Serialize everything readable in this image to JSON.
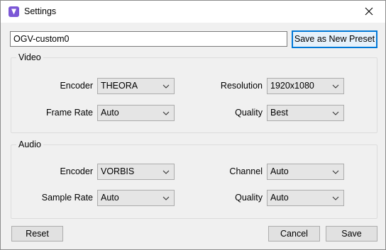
{
  "window": {
    "title": "Settings",
    "accent": "#0078d7",
    "icon_color": "#7b57d6"
  },
  "preset": {
    "value": "OGV-custom0",
    "save_button": "Save as New Preset"
  },
  "video": {
    "group_title": "Video",
    "encoder": {
      "label": "Encoder",
      "value": "THEORA"
    },
    "resolution": {
      "label": "Resolution",
      "value": "1920x1080"
    },
    "frame_rate": {
      "label": "Frame Rate",
      "value": "Auto"
    },
    "quality": {
      "label": "Quality",
      "value": "Best"
    }
  },
  "audio": {
    "group_title": "Audio",
    "encoder": {
      "label": "Encoder",
      "value": "VORBIS"
    },
    "channel": {
      "label": "Channel",
      "value": "Auto"
    },
    "sample_rate": {
      "label": "Sample Rate",
      "value": "Auto"
    },
    "quality": {
      "label": "Quality",
      "value": "Auto"
    }
  },
  "footer": {
    "reset": "Reset",
    "cancel": "Cancel",
    "save": "Save"
  }
}
